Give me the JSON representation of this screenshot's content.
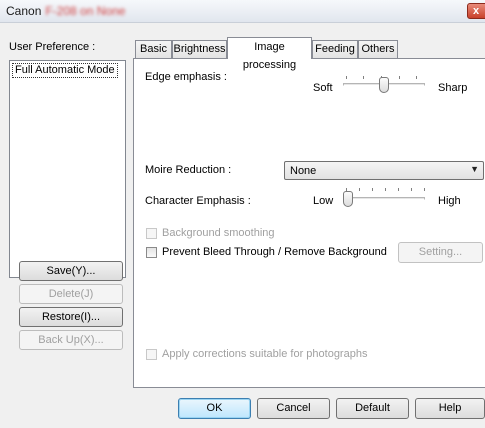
{
  "window": {
    "title_brand": "Canon",
    "title_blurred": "F-208 on None",
    "close_label": "x"
  },
  "sidebar": {
    "preference_label": "User Preference :",
    "list_items": [
      "Full Automatic Mode"
    ],
    "save_label": "Save(Y)...",
    "delete_label": "Delete(J)",
    "restore_label": "Restore(I)...",
    "backup_label": "Back Up(X)..."
  },
  "tabs": [
    "Basic",
    "Brightness",
    "Image processing",
    "Feeding",
    "Others"
  ],
  "active_tab": "Image processing",
  "image_processing": {
    "edge_label": "Edge emphasis :",
    "edge_low": "Soft",
    "edge_high": "Sharp",
    "edge_level": 0.5,
    "moire_label": "Moire Reduction :",
    "moire_value": "None",
    "char_label": "Character Emphasis :",
    "char_low": "Low",
    "char_high": "High",
    "char_level": 0.0,
    "bg_smoothing_label": "Background smoothing",
    "bleed_label": "Prevent Bleed Through / Remove Background",
    "setting_label": "Setting...",
    "photo_label": "Apply corrections suitable for photographs"
  },
  "footer": {
    "ok_label": "OK",
    "cancel_label": "Cancel",
    "default_label": "Default",
    "help_label": "Help"
  }
}
